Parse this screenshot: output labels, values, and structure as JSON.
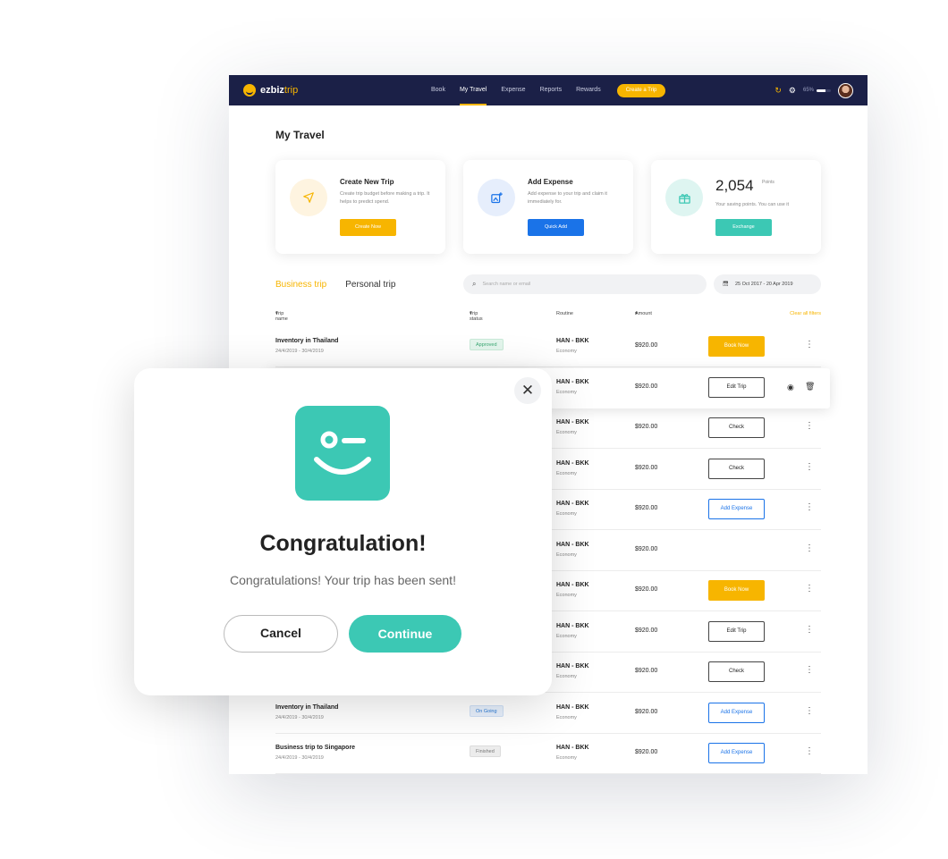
{
  "nav": {
    "logo_main": "ezbiz",
    "logo_accent": "trip",
    "links": [
      "Book",
      "My Travel",
      "Expense",
      "Reports",
      "Rewards"
    ],
    "create_trip": "Create a Trip",
    "progress_label": "65%",
    "progress_value": 0.65,
    "icons": [
      "refresh-icon",
      "gear-icon"
    ]
  },
  "page": {
    "title": "My Travel"
  },
  "cards": [
    {
      "title": "Create New Trip",
      "desc": "Create trip budget before making a trip. It helps to predict spend.",
      "button": "Create Now",
      "icon": "send-icon",
      "color": "#f7b500"
    },
    {
      "title": "Add Expense",
      "desc": "Add expense to your trip and claim it immediately for.",
      "button": "Quick Add",
      "icon": "add-image-icon",
      "color": "#1a73e8"
    },
    {
      "value": "2,054",
      "unit": "Points",
      "desc": "Your saving points. You can use it",
      "button": "Exchange",
      "icon": "gift-icon",
      "color": "#3cc8b4"
    }
  ],
  "tabs": [
    "Business trip",
    "Personal trip"
  ],
  "search": {
    "placeholder": "Search name or email"
  },
  "date_range": "25 Oct 2017 - 20 Apr 2019",
  "table": {
    "headers": {
      "name": "Trip name",
      "status": "Trip status",
      "routine": "Routine",
      "amount": "Amount",
      "clear": "Clear all filters"
    },
    "rows": [
      {
        "name": "Inventory in Thailand",
        "date": "24/4/2019 - 30/4/2019",
        "status": "Approved",
        "route": "HAN - BKK",
        "class": "Economy",
        "amount": "$920.00",
        "action": "Book Now"
      },
      {
        "route": "HAN - BKK",
        "class": "Economy",
        "amount": "$920.00",
        "action": "Edit Trip"
      },
      {
        "route": "HAN - BKK",
        "class": "Economy",
        "amount": "$920.00",
        "action": "Check"
      },
      {
        "route": "HAN - BKK",
        "class": "Economy",
        "amount": "$920.00",
        "action": "Check"
      },
      {
        "route": "HAN - BKK",
        "class": "Economy",
        "amount": "$920.00",
        "action": "Add Expense"
      },
      {
        "route": "HAN - BKK",
        "class": "Economy",
        "amount": "$920.00",
        "action": ""
      },
      {
        "route": "HAN - BKK",
        "class": "Economy",
        "amount": "$920.00",
        "action": "Book Now"
      },
      {
        "route": "HAN - BKK",
        "class": "Economy",
        "amount": "$920.00",
        "action": "Edit Trip"
      },
      {
        "route": "HAN - BKK",
        "class": "Economy",
        "amount": "$920.00",
        "action": "Check"
      },
      {
        "name": "Inventory in Thailand",
        "date": "24/4/2019 - 30/4/2019",
        "status": "On Going",
        "route": "HAN - BKK",
        "class": "Economy",
        "amount": "$920.00",
        "action": "Add Expense"
      },
      {
        "name": "Business trip to Singapore",
        "date": "24/4/2019 - 30/4/2019",
        "status": "Finished",
        "route": "HAN - BKK",
        "class": "Economy",
        "amount": "$920.00",
        "action": "Add Expense"
      }
    ]
  },
  "modal": {
    "title": "Congratulation!",
    "message": "Congratulations! Your trip has been sent!",
    "cancel": "Cancel",
    "continue": "Continue",
    "accent": "#3cc8b4"
  }
}
